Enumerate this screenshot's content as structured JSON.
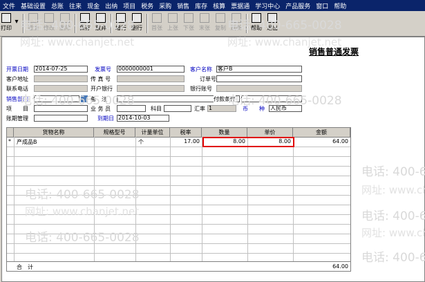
{
  "menu": [
    "文件",
    "基础设置",
    "总账",
    "往来",
    "现金",
    "出纳",
    "项目",
    "税务",
    "采购",
    "销售",
    "库存",
    "核算",
    "票据通",
    "学习中心",
    "产品服务",
    "窗口",
    "帮助"
  ],
  "toolbar": {
    "print": "打印",
    "add": "增加",
    "edit": "修改",
    "delete": "删除",
    "save": "保存",
    "abandon": "放弃",
    "add_row": "增行",
    "del_row": "删行",
    "first": "首张",
    "prev": "上张",
    "next": "下张",
    "last": "末张",
    "copy": "复制",
    "refresh": "刷新",
    "help": "帮助",
    "exit": "退出"
  },
  "form_title": "销售普通发票",
  "labels": {
    "bill_date": "开票日期",
    "invoice_no": "发票号",
    "customer_name": "客户名称",
    "cust_address": "客户地址",
    "fax": "传 真 号",
    "order_no": "订单号",
    "phone": "联系电话",
    "bank": "开户银行",
    "bank_acct": "银行账号",
    "sales_dept": "销售部门",
    "remark": "备　注",
    "pay_terms": "付款条件",
    "project": "项　　目",
    "salesman": "业 务 员",
    "subject": "科目",
    "rate": "汇率",
    "currency": "币　　种",
    "account_mgmt": "账期管理",
    "due_date": "到期日"
  },
  "values": {
    "bill_date": "2014-07-25",
    "invoice_no": "0000000001",
    "customer_name": "客户B",
    "rate": "1",
    "currency": "人民币",
    "due_date": "2014-10-03"
  },
  "grid": {
    "columns": [
      "货物名称",
      "规格型号",
      "计量单位",
      "税率",
      "数量",
      "单价",
      "金额"
    ],
    "rows": [
      {
        "marker": "*",
        "name": "产成品B",
        "spec": "",
        "unit": "个",
        "tax": "17.00",
        "qty": "8.00",
        "price": "8.00",
        "amount": "64.00"
      }
    ],
    "total_label": "合　计",
    "total_amount": "64.00"
  },
  "watermark": {
    "phone": "电话: 400-665-0028",
    "site": "网址: www.chanjet.net"
  }
}
